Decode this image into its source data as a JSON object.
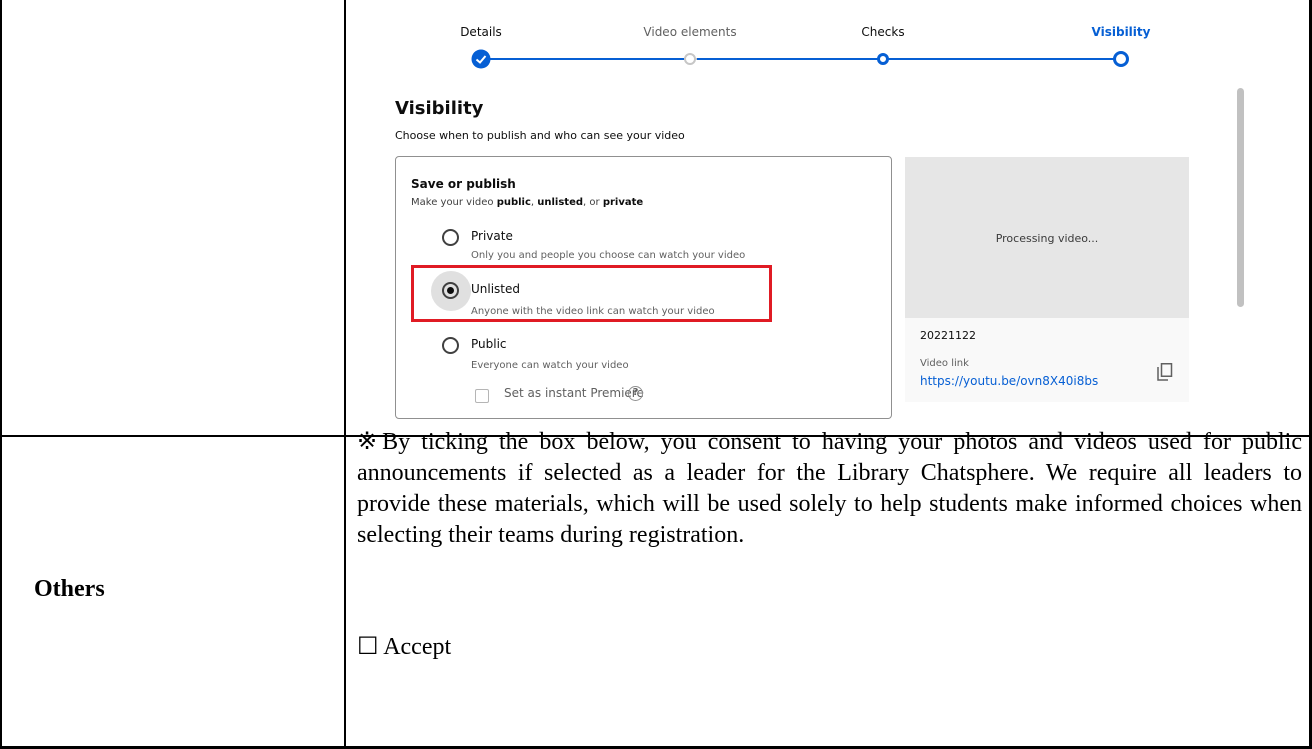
{
  "stepper": {
    "steps": [
      {
        "label": "Details",
        "state": "completed"
      },
      {
        "label": "Video elements",
        "state": "inactive"
      },
      {
        "label": "Checks",
        "state": "completed"
      },
      {
        "label": "Visibility",
        "state": "current"
      }
    ],
    "colors": {
      "accent": "#065fd4",
      "inactive": "#c6c6c6"
    }
  },
  "visibility": {
    "title": "Visibility",
    "subtitle": "Choose when to publish and who can see your video",
    "save_publish": {
      "title": "Save or publish",
      "desc_prefix": "Make your video ",
      "desc_public": "public",
      "desc_sep1": ", ",
      "desc_unlisted": "unlisted",
      "desc_sep2": ", or ",
      "desc_private": "private"
    },
    "options": [
      {
        "label": "Private",
        "desc": "Only you and people you choose can watch your video",
        "selected": false
      },
      {
        "label": "Unlisted",
        "desc": "Anyone with the video link can watch your video",
        "selected": true
      },
      {
        "label": "Public",
        "desc": "Everyone can watch your video",
        "selected": false
      }
    ],
    "premiere": {
      "label": "Set as instant Premiere",
      "checked": false,
      "help_icon": "help-circle-icon",
      "help_glyph": "?"
    },
    "highlight_color": "#e01b24"
  },
  "preview": {
    "processing": "Processing video...",
    "date": "20221122",
    "video_link_label": "Video link",
    "video_link": "https://youtu.be/ovn8X40i8bs",
    "copy_icon": "copy-icon"
  },
  "others": {
    "label": "Others",
    "consent_text": "※By ticking the box below, you consent to having your photos and videos used for public announcements if selected as a leader for the Library Chatsphere. We require all leaders to provide these materials, which will be used solely to help students make informed choices when selecting their teams during registration.",
    "accept_label": "☐ Accept"
  }
}
